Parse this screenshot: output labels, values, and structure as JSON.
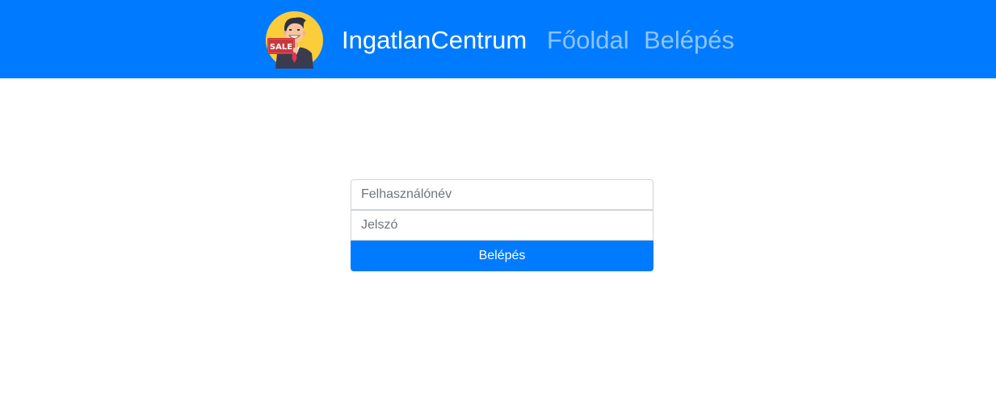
{
  "navbar": {
    "brand": "IngatlanCentrum",
    "logo_icon": "salesman-sale-logo-icon",
    "logo_sign_text": "SALE",
    "links": [
      {
        "label": "Főoldal"
      },
      {
        "label": "Belépés"
      }
    ],
    "colors": {
      "background": "#007bff",
      "brand_text": "#ffffff",
      "link_text": "rgba(255,255,255,0.55)"
    }
  },
  "login_form": {
    "username_placeholder": "Felhasználónév",
    "password_placeholder": "Jelszó",
    "submit_label": "Belépés",
    "colors": {
      "button": "#007bff",
      "input_border": "#ced4da"
    }
  }
}
